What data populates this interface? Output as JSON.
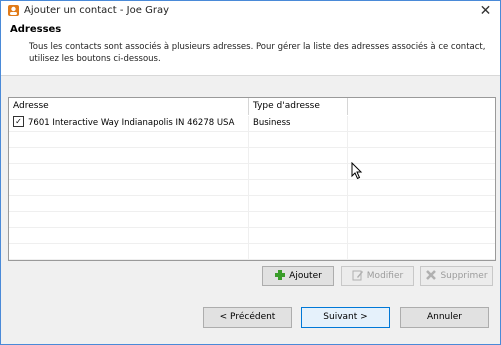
{
  "window": {
    "title": "Ajouter un contact - Joe Gray",
    "close_glyph": "✕"
  },
  "header": {
    "title": "Adresses",
    "description": "Tous les contacts sont associés à plusieurs adresses. Pour gérer la liste des adresses associés à ce contact, utilisez les boutons ci-dessous."
  },
  "list": {
    "columns": [
      "Adresse",
      "Type d'adresse"
    ],
    "rows": [
      {
        "checked": true,
        "address": "7601 Interactive Way Indianapolis IN 46278 USA",
        "type": "Business"
      }
    ]
  },
  "actions": {
    "add_label": "Ajouter",
    "edit_label": "Modifier",
    "delete_label": "Supprimer"
  },
  "nav": {
    "back_label": "< Précédent",
    "next_label": "Suivant >",
    "cancel_label": "Annuler"
  },
  "colors": {
    "window_border": "#4a8ad8",
    "add_icon": "#3a9d2a",
    "default_button_border": "#0078d7"
  }
}
